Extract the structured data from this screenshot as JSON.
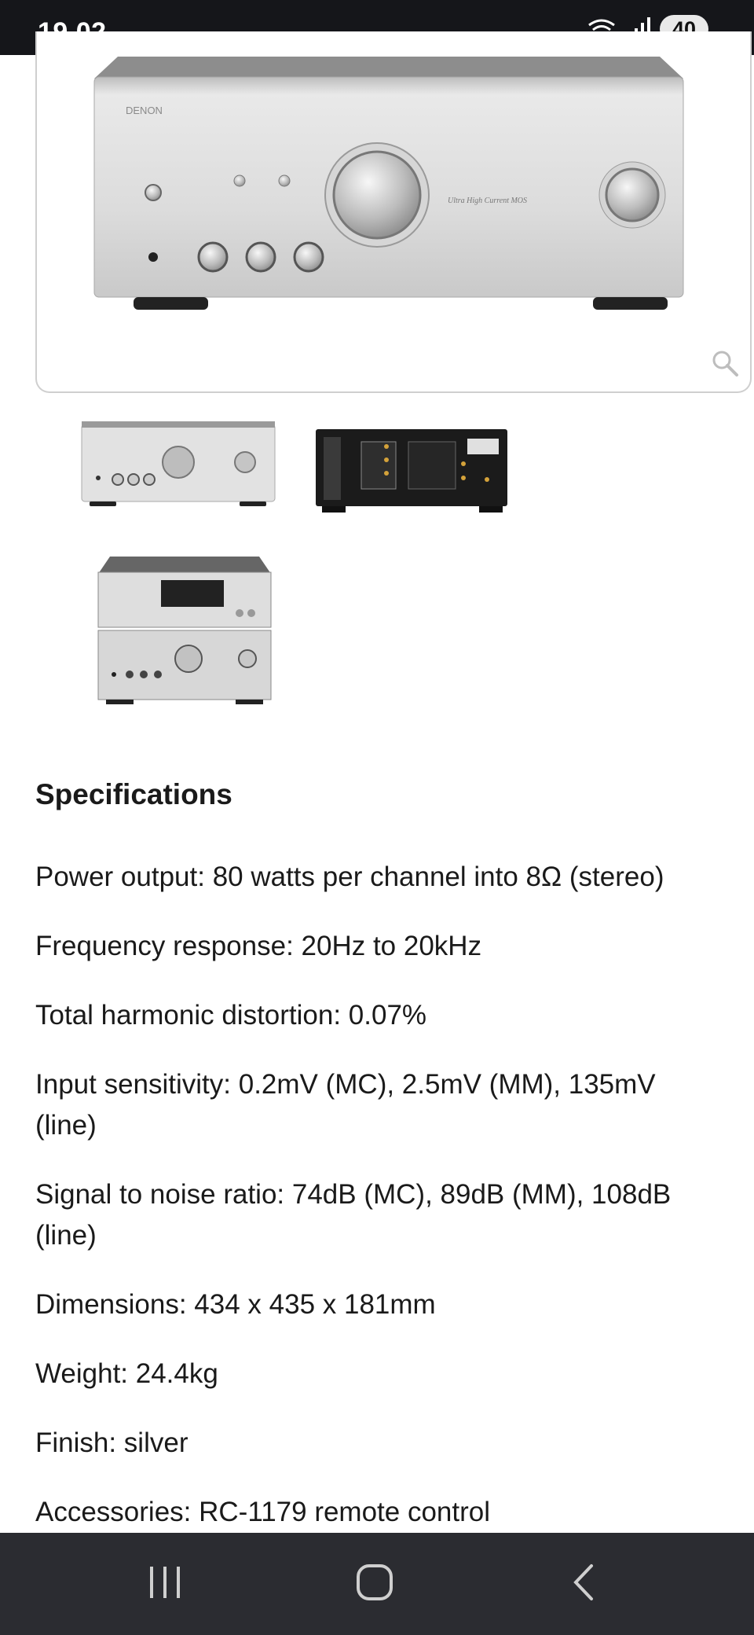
{
  "status_bar": {
    "time": "19.02",
    "battery": "40",
    "icons": [
      "wifi-calling-icon",
      "signal-icon",
      "battery-icon"
    ]
  },
  "product_images": {
    "main_alt": "Denon amplifier front view",
    "brand_mark": "DENON",
    "zoom_icon": "magnifier-icon",
    "thumbnails": [
      {
        "alt": "Front view thumbnail"
      },
      {
        "alt": "Rear panel thumbnail"
      },
      {
        "alt": "Stacked system thumbnail"
      }
    ]
  },
  "specifications": {
    "title": "Specifications",
    "items": [
      "Power output: 80 watts per channel into 8Ω (stereo)",
      "Frequency response: 20Hz to 20kHz",
      "Total harmonic distortion: 0.07%",
      "Input sensitivity: 0.2mV (MC), 2.5mV (MM), 135mV (line)",
      "Signal to noise ratio: 74dB (MC), 89dB (MM), 108dB (line)",
      "Dimensions: 434 x 435 x 181mm",
      "Weight: 24.4kg",
      "Finish: silver",
      "Accessories: RC-1179 remote control"
    ]
  },
  "navigation": {
    "buttons": [
      "recent-apps-icon",
      "home-icon",
      "back-icon"
    ]
  },
  "colors": {
    "status_bar_bg": "#15161a",
    "nav_bar_bg": "#2b2c31",
    "text": "#1a1a1a",
    "silver": "#d9d9d9"
  }
}
